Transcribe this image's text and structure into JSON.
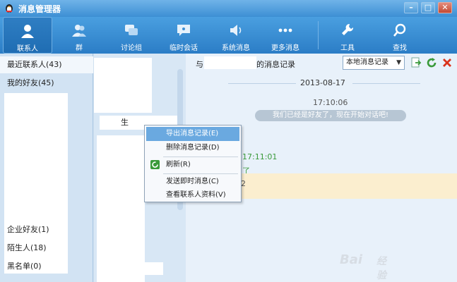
{
  "window": {
    "title": "消息管理器"
  },
  "toolbar": {
    "items": [
      {
        "label": "联系人",
        "icon": "contacts-icon"
      },
      {
        "label": "群",
        "icon": "group-icon"
      },
      {
        "label": "讨论组",
        "icon": "discussion-icon"
      },
      {
        "label": "临时会话",
        "icon": "temp-chat-icon"
      },
      {
        "label": "系统消息",
        "icon": "system-message-icon"
      },
      {
        "label": "更多消息",
        "icon": "more-icon"
      },
      {
        "label": "工具",
        "icon": "wrench-icon"
      },
      {
        "label": "查找",
        "icon": "search-icon"
      }
    ]
  },
  "sidebar": {
    "groups": [
      {
        "label": "最近联系人(43)"
      },
      {
        "label": "我的好友(45)"
      },
      {
        "label": "企业好友(1)"
      },
      {
        "label": "陌生人(18)"
      },
      {
        "label": "黑名单(0)"
      }
    ]
  },
  "contacts": {
    "visible_item": "生"
  },
  "chat": {
    "with_prefix": "与",
    "record_label": "的消息记录",
    "source_select": "本地消息记录",
    "date": "2013-08-17",
    "time1": "17:10:06",
    "system_message": "我们已经是好友了，现在开始对话吧!",
    "time2": "17:11:01",
    "fragment1": "了",
    "fragment2": "2"
  },
  "context_menu": {
    "items": [
      {
        "label": "导出消息记录(E)"
      },
      {
        "label": "删除消息记录(D)"
      },
      {
        "label": "刷新(R)"
      },
      {
        "label": "发送即时消息(C)"
      },
      {
        "label": "查看联系人资料(V)"
      }
    ]
  },
  "watermark": {
    "brand": "Bai",
    "sub": "经验"
  },
  "colors": {
    "toolbar": "#2b7dc6",
    "menu_highlight": "#6aa9e0",
    "timestamp_green": "#3a9a3a"
  }
}
